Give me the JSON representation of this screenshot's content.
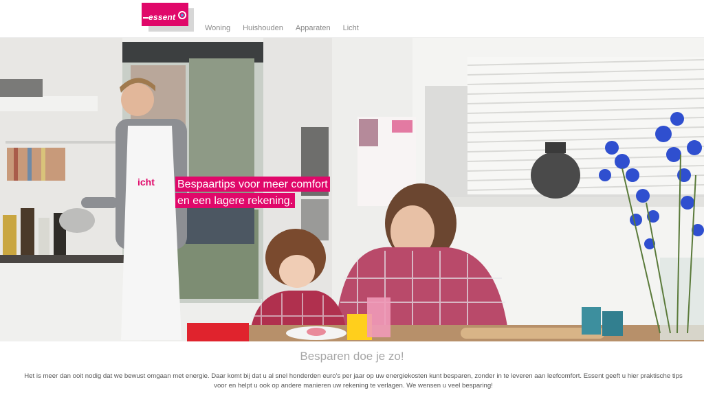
{
  "brand": {
    "logo_text": "essent"
  },
  "nav": {
    "items": [
      "Woning",
      "Huishouden",
      "Apparaten",
      "Licht"
    ]
  },
  "hero": {
    "tagline_line1": "Bespaartips voor meer comfort",
    "tagline_line2": "en een lagere rekening.",
    "apron_text": "icht"
  },
  "content": {
    "heading": "Besparen doe je zo!",
    "body": "Het is meer dan ooit nodig dat we bewust omgaan met energie. Daar komt bij dat u al snel honderden euro's per jaar op uw energiekosten kunt besparen, zonder in te leveren aan leefcomfort. Essent geeft u hier praktische tips voor en helpt u ook op andere manieren uw rekening te verlagen. We wensen u veel besparing!"
  },
  "colors": {
    "brand_pink": "#e0086a",
    "heading_gray": "#a6a6a6"
  }
}
